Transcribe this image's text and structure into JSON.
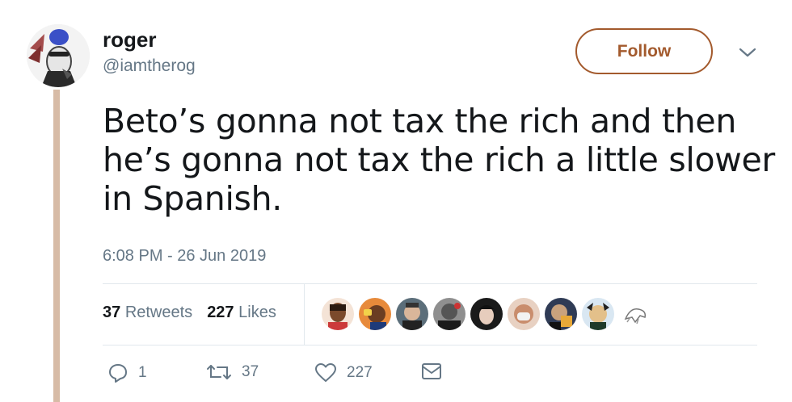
{
  "user": {
    "name": "roger",
    "handle": "@iamtherog"
  },
  "follow_label": "Follow",
  "tweet": {
    "lines": [
      "Beto’s gonna not tax the rich and then",
      "he’s gonna not tax the rich a little slower",
      "in Spanish."
    ],
    "timestamp": "6:08 PM - 26 Jun 2019"
  },
  "stats": {
    "retweets_count": "37",
    "retweets_label": "Retweets",
    "likes_count": "227",
    "likes_label": "Likes"
  },
  "actions": {
    "reply_count": "1",
    "retweet_count": "37",
    "like_count": "227"
  },
  "colors": {
    "accent": "#a35a2d",
    "thread_line": "#d7bba6",
    "secondary_text": "#657786",
    "divider": "#e1e8ed"
  },
  "icons": {
    "reply": "reply-icon",
    "retweet": "retweet-icon",
    "like": "heart-icon",
    "dm": "envelope-icon",
    "caret": "chevron-down-icon"
  }
}
